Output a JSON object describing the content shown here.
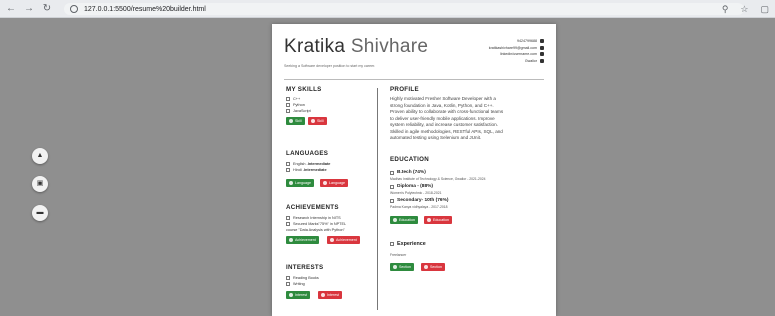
{
  "browser": {
    "url": "127.0.0.1:5500/resume%20builder.html",
    "back_icon": "arrow-left-icon",
    "forward_icon": "arrow-right-icon",
    "reload_icon": "reload-icon"
  },
  "side_buttons": [
    {
      "icon": "upload-icon",
      "glyph": "▲"
    },
    {
      "icon": "save-icon",
      "glyph": "▣"
    },
    {
      "icon": "print-icon",
      "glyph": "▬"
    }
  ],
  "resume": {
    "first_name": "Kratika",
    "last_name": "Shivhare",
    "tagline": "Seeking a Software developer position to start my career.",
    "contact": {
      "phone": "9424799688",
      "email": "kratikashivhare99@gmail.com",
      "linkedin": "linkedin/username.com",
      "location": "Gwalior"
    },
    "skills": {
      "title": "MY SKILLS",
      "items": [
        "C++",
        "Python",
        "JavaScript"
      ],
      "add_label": "Skill",
      "remove_label": "Skill"
    },
    "languages": {
      "title": "LANGUAGES",
      "items": [
        {
          "name": "English - ",
          "level": "Intermediate"
        },
        {
          "name": "Hindi - ",
          "level": "Intermediate"
        }
      ],
      "add_label": "Language",
      "remove_label": "Language"
    },
    "achievements": {
      "title": "ACHIEVEMENTS",
      "items": [
        "Research Internship in NITS",
        "Secured Marks\"75%\" in NPTEL",
        "course \"Data Analysis with Python\""
      ],
      "add_label": "Achievement",
      "remove_label": "Achievement"
    },
    "interests": {
      "title": "INTERESTS",
      "items": [
        "Reading Books",
        "Writing"
      ],
      "add_label": "Interest",
      "remove_label": "Interest"
    },
    "profile": {
      "title": "PROFILE",
      "lines": [
        "Highly motivated Fresher Software Developer with a",
        "strong foundation in Java, Kotlin, Python, and C++.",
        "Proven ability to collaborate with cross-functional teams",
        "to deliver user-friendly mobile applications. Improve",
        "system reliability, and increase customer satisfaction.",
        "Skilled in agile methodologies, RESTful APIs, SQL, and",
        "automated testing using Selenium and JUnit."
      ]
    },
    "education": {
      "title": "EDUCATION",
      "entries": [
        {
          "degree": "B.tech (74%)",
          "detail": "Madhav Institute of Technology & Science, Gwalior - 2021-2024"
        },
        {
          "degree": "Diploma - (88%)",
          "detail": "Women's Polytechnic - 2018-2021"
        },
        {
          "degree": "Secondary- 10th (76%)",
          "detail": "Padma Kanya vidhyalaya - 2017-2018"
        }
      ],
      "add_label": "Education",
      "remove_label": "Education"
    },
    "experience": {
      "title": "Experience",
      "detail": "Freelancer",
      "add_label": "Section",
      "remove_label": "Section"
    }
  }
}
